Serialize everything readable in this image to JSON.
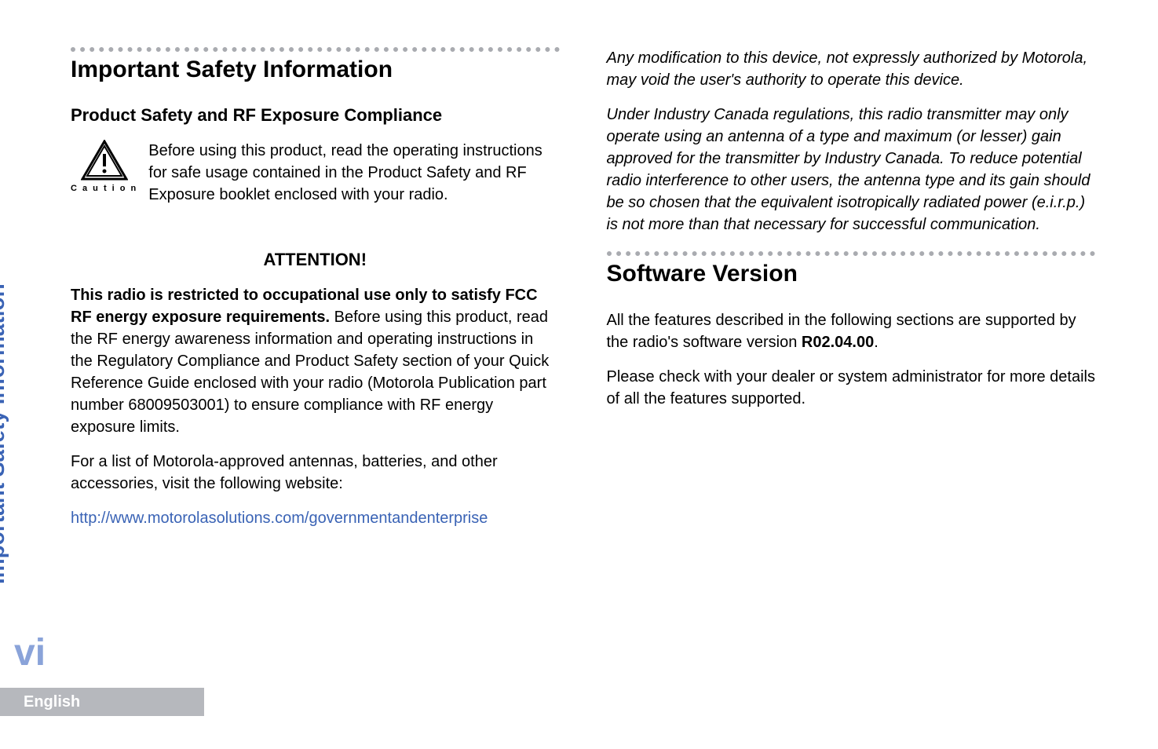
{
  "sideTab": "Important Safety Information",
  "pageNumber": "vi",
  "footer": "English",
  "left": {
    "heading1": "Important Safety Information",
    "heading2": "Product Safety and RF Exposure Compliance",
    "cautionText": "Before using this product, read the operating instructions for safe usage contained in the Product Safety and RF Exposure booklet enclosed with your radio.",
    "cautionLabel": "C a u t i o n",
    "attention": "ATTENTION!",
    "para1_bold": "This radio is restricted to occupational use only to satisfy FCC RF energy exposure requirements.",
    "para1_rest": " Before using this product, read the RF energy awareness information and operating instructions in the Regulatory Compliance and Product Safety section of your Quick Reference Guide enclosed with your radio (Motorola Publication part number 68009503001) to ensure compliance with RF energy exposure limits.",
    "para2": "For a list of Motorola-approved antennas, batteries, and other accessories, visit the following website:",
    "link": "http://www.motorolasolutions.com/governmentandenterprise"
  },
  "right": {
    "italic1": "Any modification to this device, not expressly authorized by Motorola, may void the user's authority to operate this device.",
    "italic2": "Under Industry Canada regulations, this radio transmitter may only operate using an antenna of a type and maximum (or lesser) gain approved for the transmitter by Industry Canada. To reduce potential radio interference to other users, the antenna type and its gain should be so chosen that the equivalent isotropically radiated power (e.i.r.p.) is not more than that necessary for successful communication.",
    "heading1": "Software Version",
    "para1_a": "All the features described in the following sections are supported by the radio's software version ",
    "para1_version": "R02.04.00",
    "para1_b": ".",
    "para2": "Please check with your dealer or system administrator for more details of all the features supported."
  }
}
